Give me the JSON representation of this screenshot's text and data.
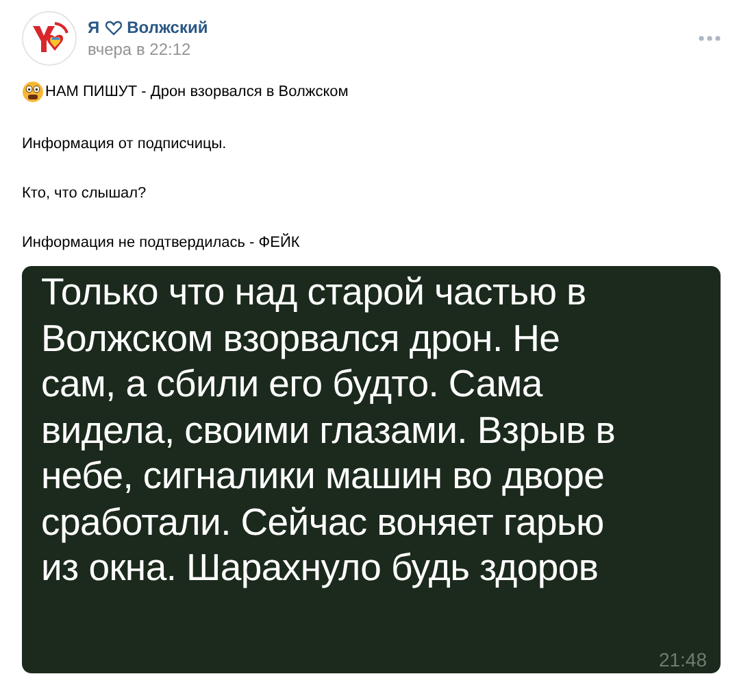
{
  "post": {
    "author_prefix": "Я",
    "author_name": "Волжский",
    "time": "вчера в 22:12",
    "paragraphs": [
      "НАМ ПИШУТ - Дрон взорвался в Волжском",
      "Информация от подписчицы.",
      "Кто, что слышал?",
      "Информация не подтвердилась - ФЕЙК"
    ],
    "screenshot": {
      "lines": [
        "Только что над старой частью в",
        "Волжском взорвался дрон. Не",
        "сам, а сбили его будто. Сама",
        "видела, своими глазами. Взрыв в",
        "небе, сигналики машин во дворе",
        "сработали. Сейчас воняет гарью",
        "из окна. Шарахнуло будь здоров"
      ],
      "time": "21:48"
    }
  }
}
